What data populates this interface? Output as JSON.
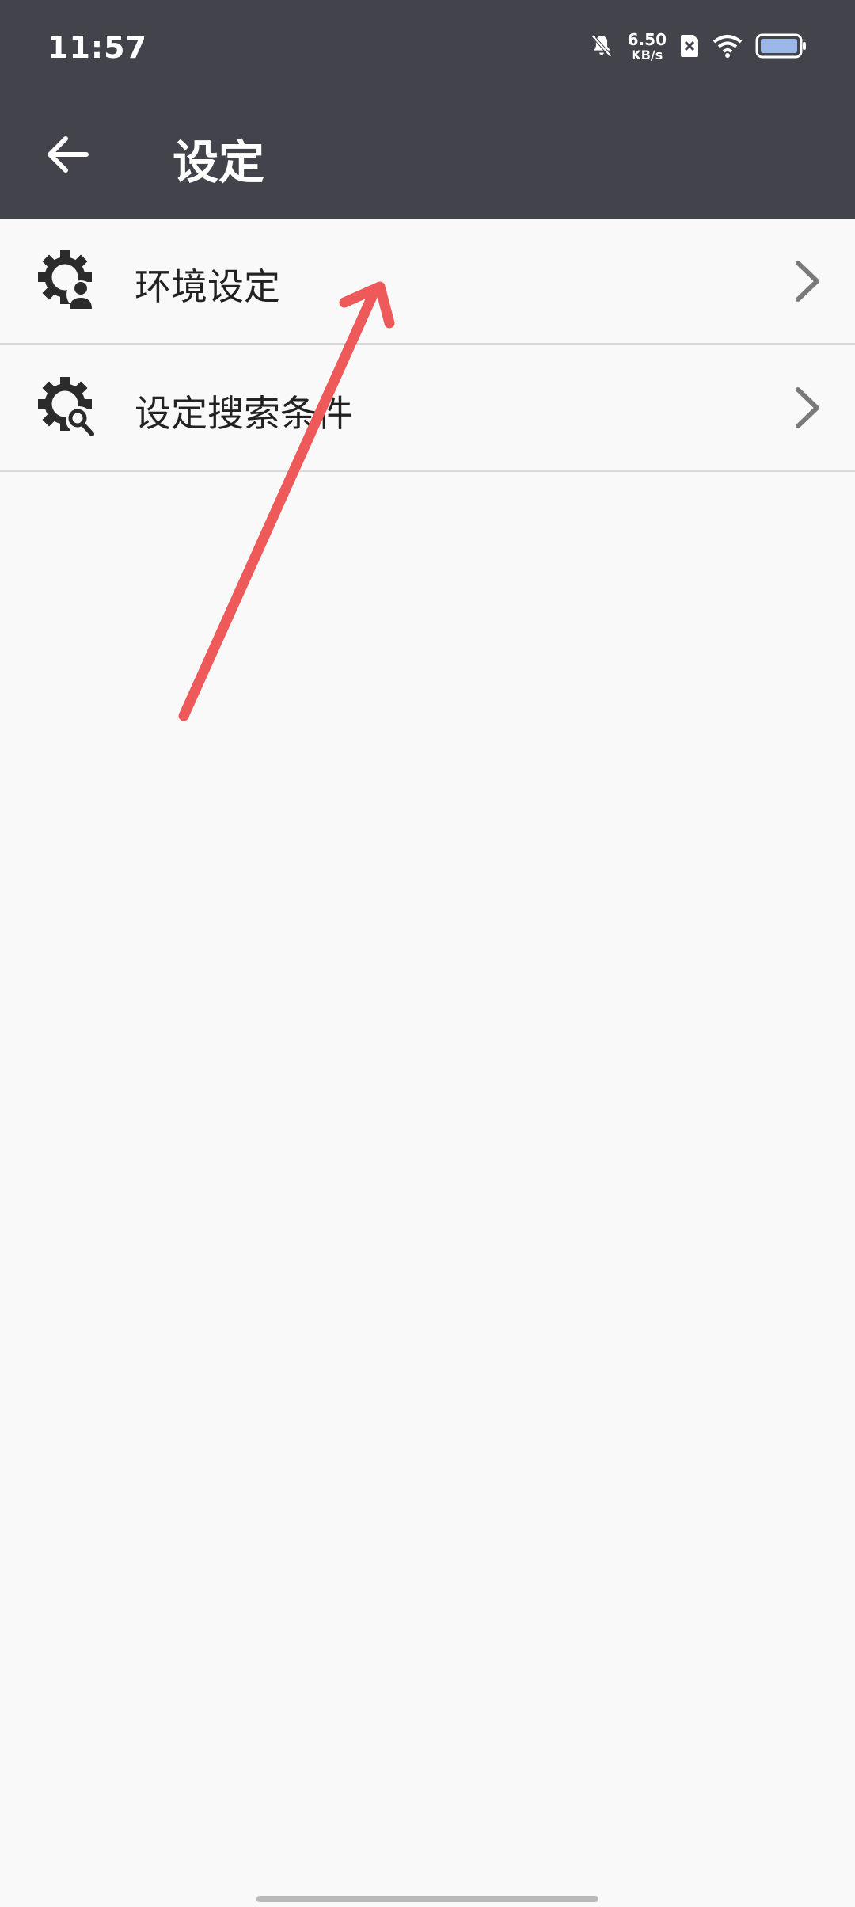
{
  "status_bar": {
    "time": "11:57",
    "net_speed_value": "6.50",
    "net_speed_unit": "KB/s",
    "icons": [
      "bell-off-icon",
      "sim-blocked-icon",
      "wifi-icon",
      "battery-icon"
    ]
  },
  "app_bar": {
    "title": "设定",
    "back_icon": "arrow-left-icon"
  },
  "menu": {
    "items": [
      {
        "label": "环境设定",
        "icon": "gear-user-icon"
      },
      {
        "label": "设定搜索条件",
        "icon": "gear-search-icon"
      }
    ]
  },
  "colors": {
    "app_bar_bg": "#42434b",
    "page_bg": "#f9f9f9",
    "annotation_arrow": "#ee5a5a"
  }
}
